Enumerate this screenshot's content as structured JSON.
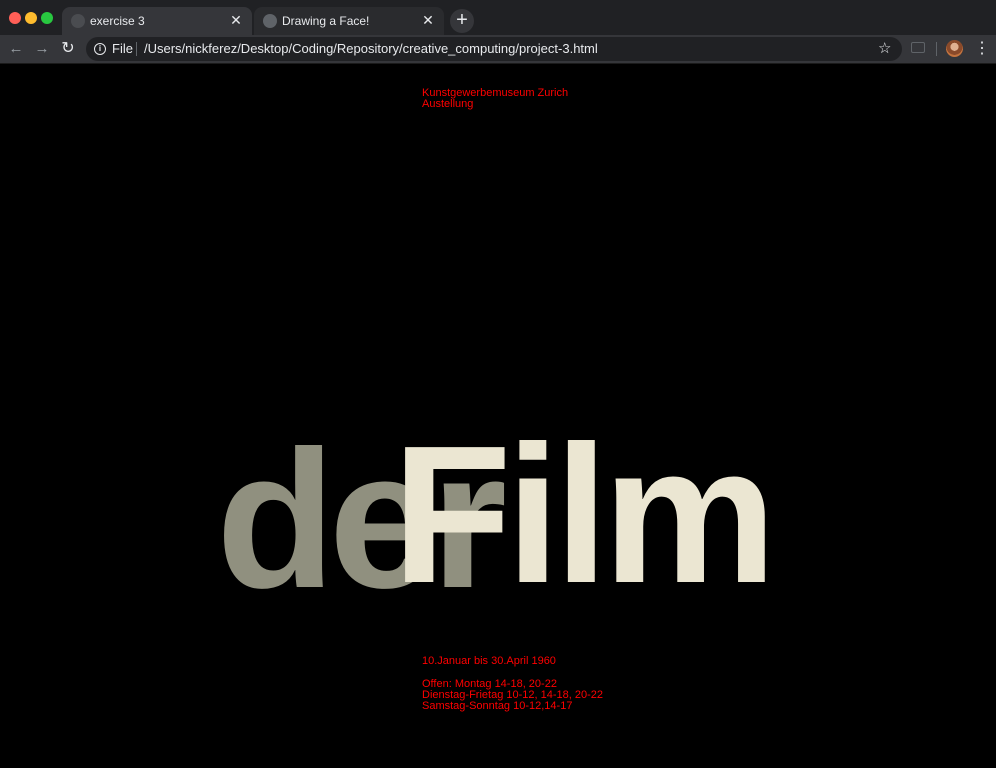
{
  "browser": {
    "tabs": [
      {
        "title": "exercise 3",
        "close": "✕"
      },
      {
        "title": "Drawing a Face!",
        "close": "✕"
      }
    ],
    "new_tab": "+",
    "nav": {
      "back": "←",
      "forward": "→",
      "reload": "↻"
    },
    "address": {
      "scheme_label": "File",
      "url": "/Users/nickferez/Desktop/Coding/Repository/creative_computing/project-3.html"
    },
    "bookmark_star": "☆",
    "menu": "⋮",
    "colors": {
      "tabstrip": "#202124",
      "toolbar": "#35363a",
      "omnibox": "#202124"
    }
  },
  "poster": {
    "header": {
      "line1": "Kunstgewerbemuseum Zurich",
      "line2": "Austellung"
    },
    "title_left": "der",
    "title_right": "Film",
    "date": "10.Januar bis 30.April 1960",
    "hours": {
      "line1": "Offen: Montag 14-18, 20-22",
      "line2": "Dienstag-Frietag 10-12, 14-18, 20-22",
      "line3": "Samstag-Sonntag 10-12,14-17"
    },
    "colors": {
      "background": "#000000",
      "info_text": "#ff0000",
      "title_left": "#90907f",
      "title_right": "#ebe6d2"
    }
  }
}
